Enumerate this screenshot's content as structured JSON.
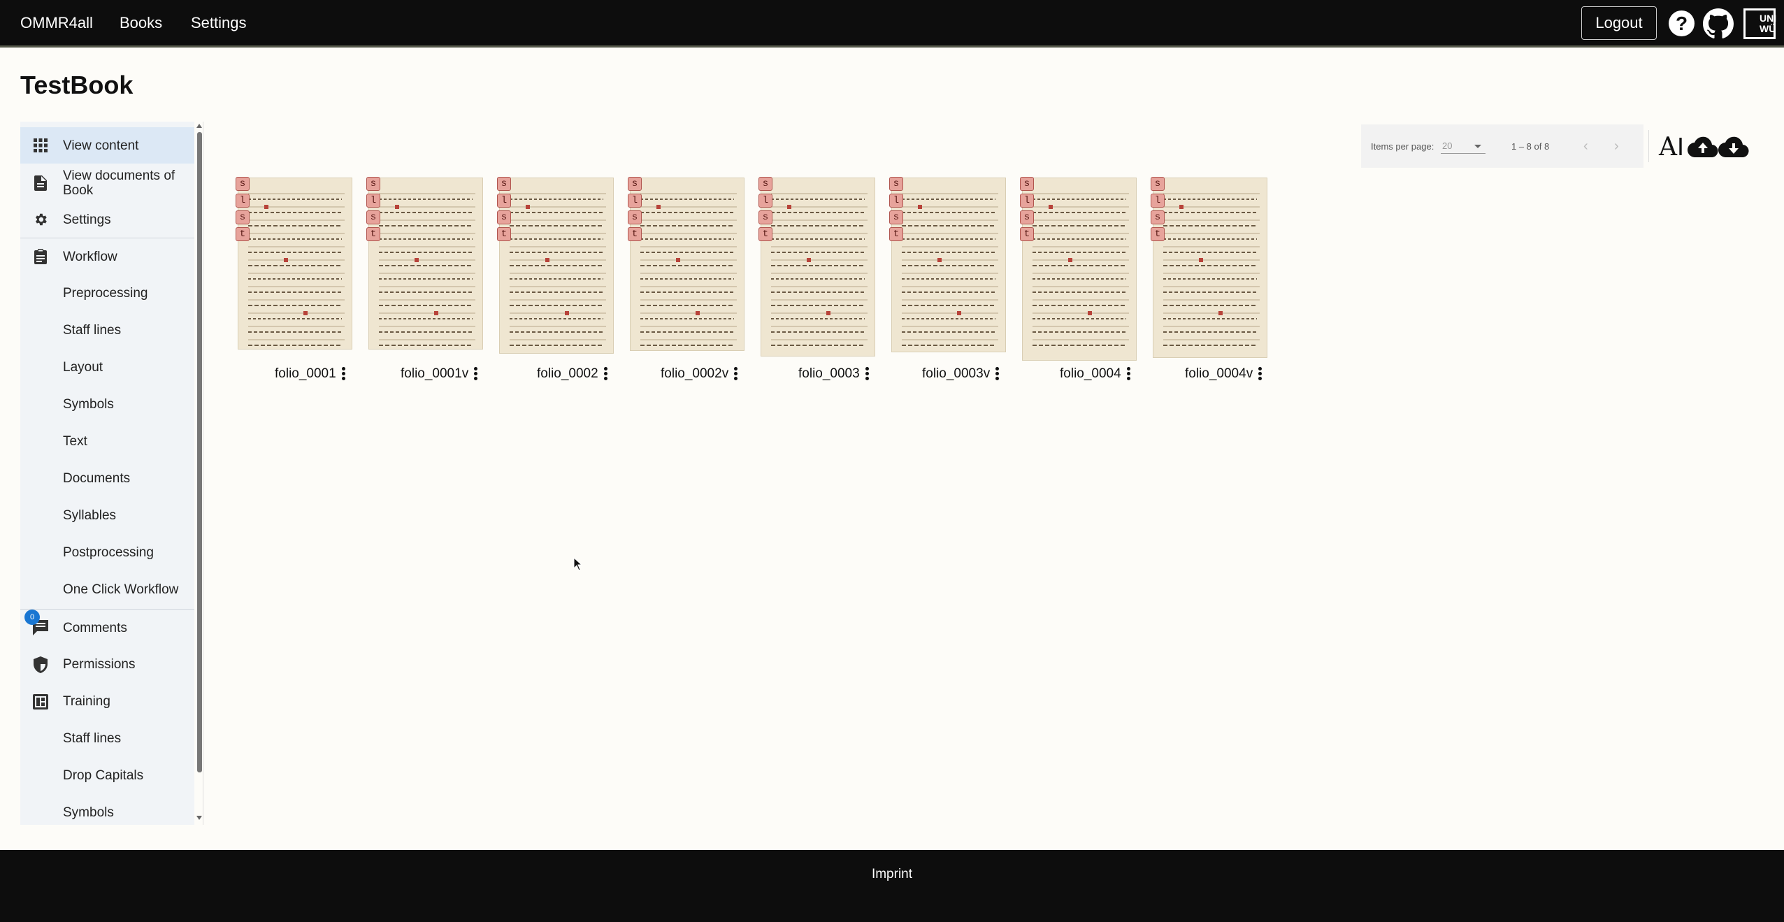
{
  "header": {
    "brand": "OMMR4all",
    "nav": [
      "Books",
      "Settings"
    ],
    "logout_label": "Logout",
    "help_label": "?",
    "uni_logo_text": "UNI WÜ"
  },
  "page_title": "TestBook",
  "sidebar": {
    "items": [
      {
        "label": "View content",
        "icon": "grid-icon",
        "active": true
      },
      {
        "label": "View documents of Book",
        "icon": "document-icon"
      },
      {
        "label": "Settings",
        "icon": "gear-icon"
      },
      {
        "label": "Workflow",
        "icon": "clipboard-icon"
      },
      {
        "label": "Preprocessing"
      },
      {
        "label": "Staff lines"
      },
      {
        "label": "Layout"
      },
      {
        "label": "Symbols"
      },
      {
        "label": "Text"
      },
      {
        "label": "Documents"
      },
      {
        "label": "Syllables"
      },
      {
        "label": "Postprocessing"
      },
      {
        "label": "One Click Workflow"
      },
      {
        "label": "Comments",
        "icon": "comment-icon",
        "badge": "0"
      },
      {
        "label": "Permissions",
        "icon": "shield-icon"
      },
      {
        "label": "Training",
        "icon": "training-icon"
      },
      {
        "label": "Staff lines"
      },
      {
        "label": "Drop Capitals"
      },
      {
        "label": "Symbols"
      }
    ]
  },
  "paginator": {
    "items_per_page_label": "Items per page:",
    "items_per_page_value": "20",
    "range_label": "1 – 8 of 8"
  },
  "toolbar_icons": [
    "ai-text-icon",
    "cloud-upload-icon",
    "cloud-download-icon"
  ],
  "pages": [
    {
      "name": "folio_0001",
      "status": [
        "s",
        "l",
        "s",
        "t"
      ]
    },
    {
      "name": "folio_0001v",
      "status": [
        "s",
        "l",
        "s",
        "t"
      ]
    },
    {
      "name": "folio_0002",
      "status": [
        "s",
        "l",
        "s",
        "t"
      ]
    },
    {
      "name": "folio_0002v",
      "status": [
        "s",
        "l",
        "s",
        "t"
      ]
    },
    {
      "name": "folio_0003",
      "status": [
        "s",
        "l",
        "s",
        "t"
      ]
    },
    {
      "name": "folio_0003v",
      "status": [
        "s",
        "l",
        "s",
        "t"
      ]
    },
    {
      "name": "folio_0004",
      "status": [
        "s",
        "l",
        "s",
        "t"
      ]
    },
    {
      "name": "folio_0004v",
      "status": [
        "s",
        "l",
        "s",
        "t"
      ]
    }
  ],
  "footer": {
    "imprint_label": "Imprint"
  },
  "colors": {
    "topbar": "#0d0d0d",
    "accent": "#1976d2",
    "chip": "#e7a39b",
    "sidebar_bg": "#f1f4f7",
    "active_bg": "#dce8f5"
  }
}
